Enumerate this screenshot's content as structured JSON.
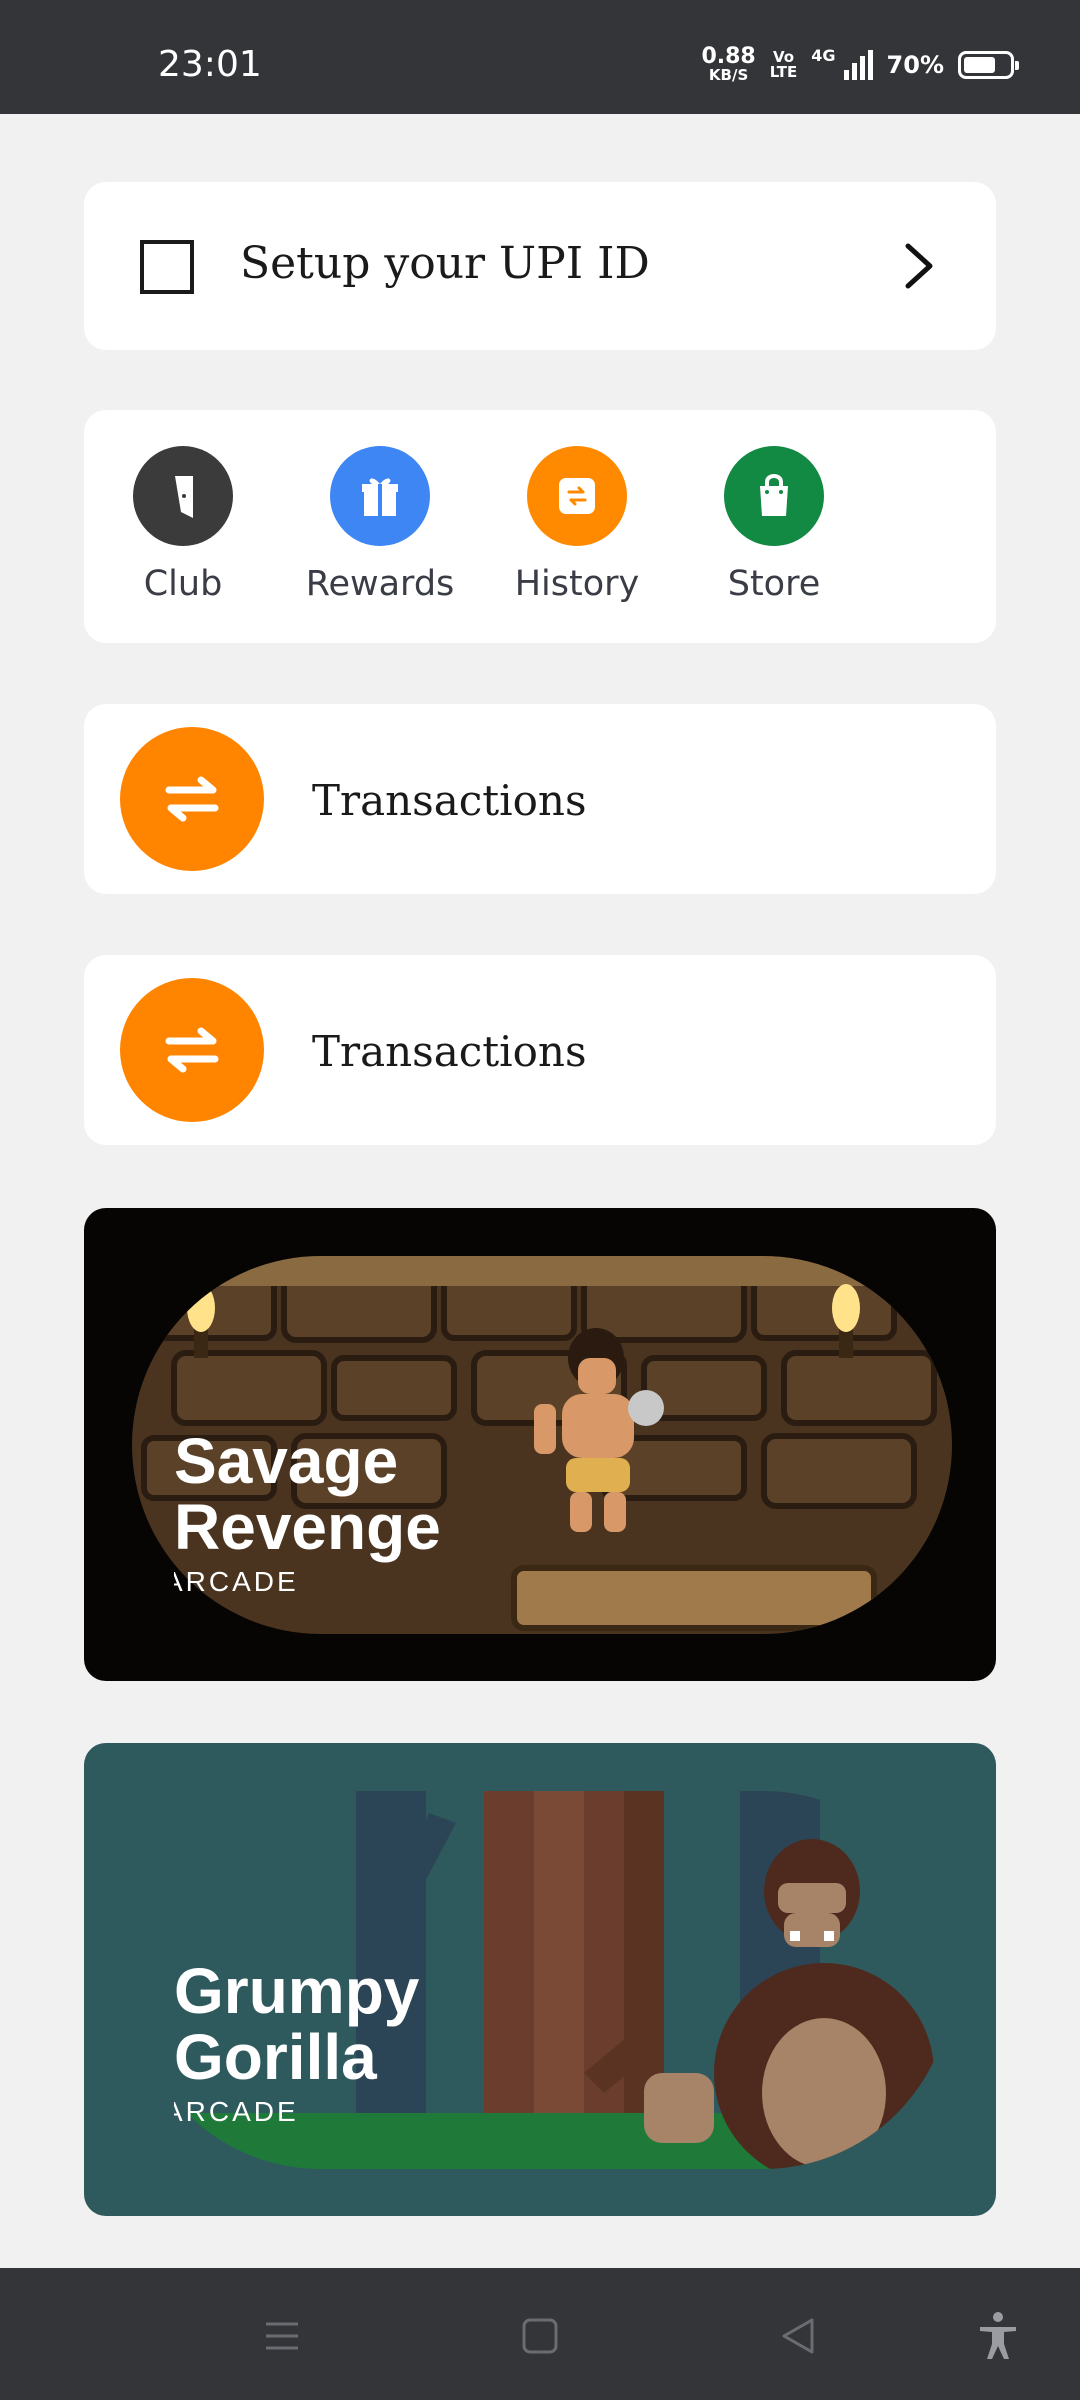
{
  "status_bar": {
    "time": "23:01",
    "net_speed_value": "0.88",
    "net_speed_unit": "KB/S",
    "volte_top": "Vo",
    "volte_bottom": "LTE",
    "network": "4G",
    "battery": "70%",
    "battery_level": 0.7
  },
  "upi": {
    "label": "Setup your UPI ID",
    "checked": false
  },
  "shortcuts": [
    {
      "label": "Club",
      "icon": "door-icon",
      "color": "#3b3b3b"
    },
    {
      "label": "Rewards",
      "icon": "gift-icon",
      "color": "#3f86f5"
    },
    {
      "label": "History",
      "icon": "history-icon",
      "color": "#ff8a00"
    },
    {
      "label": "Store",
      "icon": "shopping-bag-icon",
      "color": "#138a43"
    }
  ],
  "transactions": [
    {
      "label": "Transactions",
      "icon": "swap-arrows-icon",
      "color": "#ff8400"
    },
    {
      "label": "Transactions",
      "icon": "swap-arrows-icon",
      "color": "#ff8400"
    }
  ],
  "games": [
    {
      "title_line1": "Savage",
      "title_line2": "Revenge",
      "genre": "ARCADE"
    },
    {
      "title_line1": "Grumpy",
      "title_line2": "Gorilla",
      "genre": "ARCADE"
    }
  ],
  "nav_bar": {
    "icons": [
      "menu-icon",
      "home-square-icon",
      "back-triangle-icon",
      "accessibility-icon"
    ]
  }
}
